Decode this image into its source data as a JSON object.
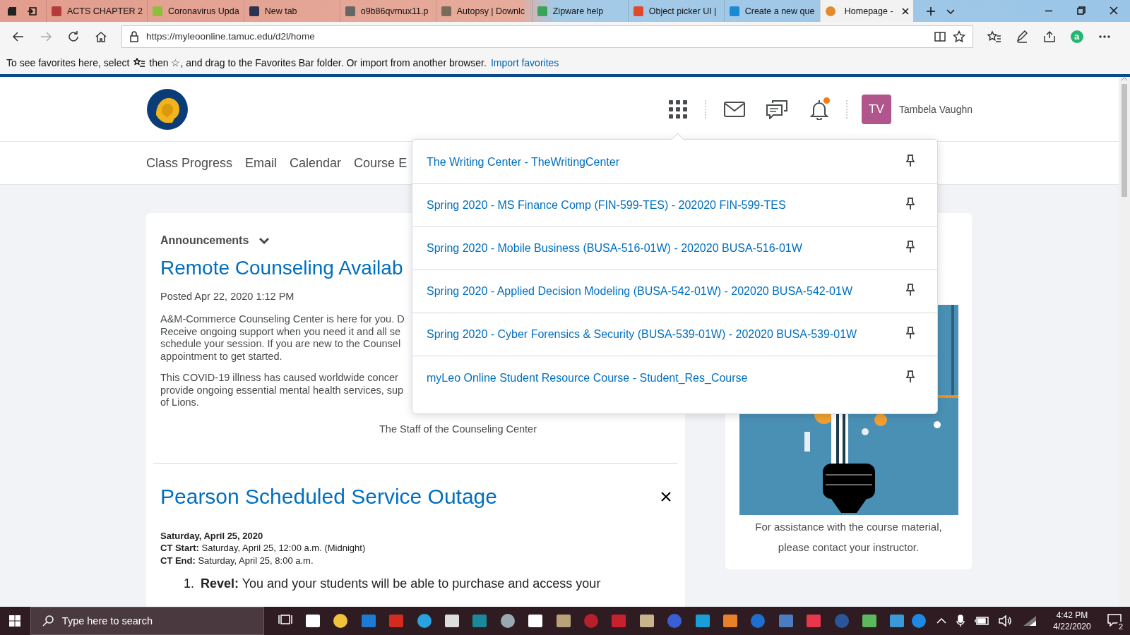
{
  "browser": {
    "tabs": [
      {
        "title": "ACTS CHAPTER 2",
        "selected": false
      },
      {
        "title": "Coronavirus Upda",
        "selected": false
      },
      {
        "title": "New tab",
        "selected": false
      },
      {
        "title": "o9b86qvrnux11.p",
        "selected": false
      },
      {
        "title": "Autopsy | Downlc",
        "selected": false
      },
      {
        "title": "Zipware help",
        "selected": false
      },
      {
        "title": "Object picker UI |",
        "selected": false
      },
      {
        "title": "Create a new que",
        "selected": false
      },
      {
        "title": "Homepage -",
        "selected": true
      }
    ],
    "address": "https://myleoonline.tamuc.edu/d2l/home",
    "extension_badge": "a",
    "favorites_bar": {
      "before": "To see favorites here, select",
      "after": "then ☆, and drag to the Favorites Bar folder. Or import from another browser.",
      "link": "Import favorites"
    }
  },
  "header": {
    "notifications_unread": true,
    "user": {
      "initials": "TV",
      "name": "Tambela Vaughn"
    }
  },
  "nav": [
    "Class Progress",
    "Email",
    "Calendar",
    "Course E"
  ],
  "courses_menu": [
    {
      "title": "The Writing Center - TheWritingCenter"
    },
    {
      "title": "Spring 2020 - MS Finance Comp (FIN-599-TES) - 202020 FIN-599-TES"
    },
    {
      "title": "Spring 2020 - Mobile Business (BUSA-516-01W) - 202020 BUSA-516-01W"
    },
    {
      "title": "Spring 2020 - Applied Decision Modeling (BUSA-542-01W) - 202020 BUSA-542-01W"
    },
    {
      "title": "Spring 2020 - Cyber Forensics & Security (BUSA-539-01W) - 202020 BUSA-539-01W"
    },
    {
      "title": "myLeo Online Student Resource Course - Student_Res_Course"
    }
  ],
  "announcements": {
    "heading": "Announcements",
    "items": [
      {
        "kind": "post",
        "dismissible": false,
        "title": "Remote Counseling Availab",
        "posted": "Posted Apr 22, 2020 1:12 PM",
        "paragraphs": [
          [
            "A&M-Commerce Counseling Center is here for you. D",
            "Receive ongoing support when you need it and all se",
            "schedule your session. If you are new to the Counsel",
            "appointment to get started."
          ],
          [
            "This COVID-19 illness has caused worldwide concer",
            "provide ongoing essential mental health services, sup",
            "of Lions."
          ]
        ],
        "signature": "The Staff of the Counseling Center"
      },
      {
        "kind": "outage",
        "dismissible": true,
        "title": "Pearson Scheduled Service Outage",
        "date": "Saturday, April 25, 2020",
        "details": [
          "**CT Start:** Saturday, April 25, 12:00 a.m. (Midnight)",
          "**CT End:** Saturday, April 25, 8:00 a.m."
        ],
        "list": [
          {
            "number": "1.",
            "text": "**Revel:** You and your students will be able to purchase and access your"
          }
        ]
      }
    ]
  },
  "side_card": {
    "caption": "For assistance with the course material, please contact your instructor."
  },
  "taskbar": {
    "search_placeholder": "Type here to search",
    "time": "4:42 PM",
    "date": "4/22/2020",
    "notification_count": "2"
  }
}
